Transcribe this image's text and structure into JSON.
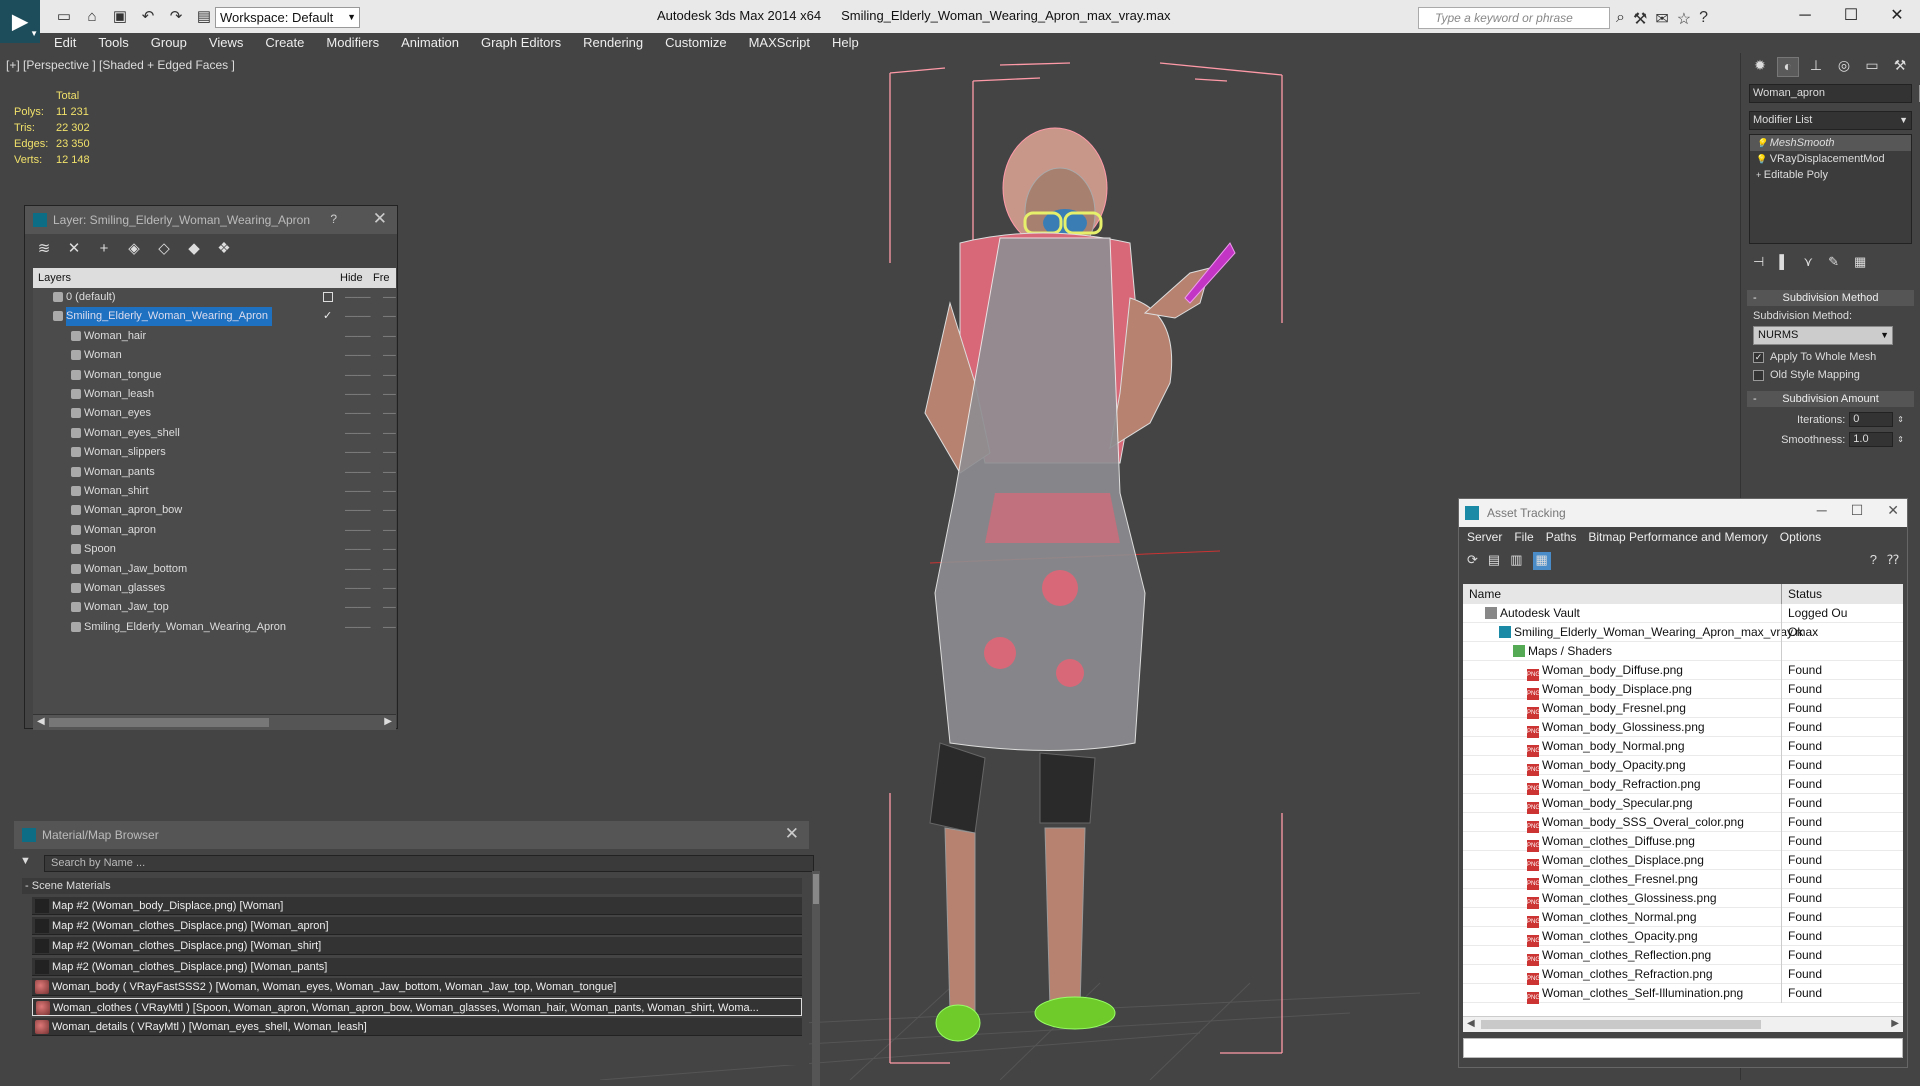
{
  "app": {
    "title": "Autodesk 3ds Max  2014 x64",
    "filename": "Smiling_Elderly_Woman_Wearing_Apron_max_vray.max",
    "workspace": "Workspace: Default",
    "search_placeholder": "Type a keyword or phrase"
  },
  "menu": [
    "Edit",
    "Tools",
    "Group",
    "Views",
    "Create",
    "Modifiers",
    "Animation",
    "Graph Editors",
    "Rendering",
    "Customize",
    "MAXScript",
    "Help"
  ],
  "viewport": {
    "label": "[+] [Perspective ] [Shaded + Edged Faces ]",
    "stats": {
      "header": "Total",
      "rows": [
        {
          "label": "Polys:",
          "value": "11 231"
        },
        {
          "label": "Tris:",
          "value": "22 302"
        },
        {
          "label": "Edges:",
          "value": "23 350"
        },
        {
          "label": "Verts:",
          "value": "12 148"
        }
      ]
    }
  },
  "layer_panel": {
    "title": "Layer: Smiling_Elderly_Woman_Wearing_Apron",
    "help": "?",
    "col_layers": "Layers",
    "col_hide": "Hide",
    "col_freeze": "Fre",
    "rows": [
      {
        "name": "0 (default)",
        "indent": 0
      },
      {
        "name": "Smiling_Elderly_Woman_Wearing_Apron",
        "indent": 0,
        "selected": true
      },
      {
        "name": "Woman_hair",
        "indent": 1
      },
      {
        "name": "Woman",
        "indent": 1
      },
      {
        "name": "Woman_tongue",
        "indent": 1
      },
      {
        "name": "Woman_leash",
        "indent": 1
      },
      {
        "name": "Woman_eyes",
        "indent": 1
      },
      {
        "name": "Woman_eyes_shell",
        "indent": 1
      },
      {
        "name": "Woman_slippers",
        "indent": 1
      },
      {
        "name": "Woman_pants",
        "indent": 1
      },
      {
        "name": "Woman_shirt",
        "indent": 1
      },
      {
        "name": "Woman_apron_bow",
        "indent": 1
      },
      {
        "name": "Woman_apron",
        "indent": 1
      },
      {
        "name": "Spoon",
        "indent": 1
      },
      {
        "name": "Woman_Jaw_bottom",
        "indent": 1
      },
      {
        "name": "Woman_glasses",
        "indent": 1
      },
      {
        "name": "Woman_Jaw_top",
        "indent": 1
      },
      {
        "name": "Smiling_Elderly_Woman_Wearing_Apron",
        "indent": 1
      }
    ]
  },
  "material_browser": {
    "title": "Material/Map Browser",
    "search_placeholder": "Search by Name ...",
    "group": "Scene Materials",
    "rows": [
      {
        "text": "Map #2 (Woman_body_Displace.png) [Woman]",
        "kind": "map"
      },
      {
        "text": "Map #2 (Woman_clothes_Displace.png) [Woman_apron]",
        "kind": "map"
      },
      {
        "text": "Map #2 (Woman_clothes_Displace.png) [Woman_shirt]",
        "kind": "map"
      },
      {
        "text": "Map #2 (Woman_clothes_Displace.png) [Woman_pants]",
        "kind": "map"
      },
      {
        "text": "Woman_body  ( VRayFastSSS2 )  [Woman, Woman_eyes, Woman_Jaw_bottom, Woman_Jaw_top, Woman_tongue]",
        "kind": "mat"
      },
      {
        "text": "Woman_clothes  ( VRayMtl )  [Spoon, Woman_apron, Woman_apron_bow, Woman_glasses, Woman_hair, Woman_pants, Woman_shirt, Woma...",
        "kind": "mat",
        "selected": true
      },
      {
        "text": "Woman_details  ( VRayMtl )  [Woman_eyes_shell, Woman_leash]",
        "kind": "mat"
      }
    ]
  },
  "command_panel": {
    "object_name": "Woman_apron",
    "modifier_list": "Modifier List",
    "stack": [
      "MeshSmooth",
      "VRayDisplacementMod",
      "Editable Poly"
    ],
    "subdivision_method_rollout": "Subdivision Method",
    "subdivision_method_label": "Subdivision Method:",
    "subdivision_method_value": "NURMS",
    "apply_whole_mesh": "Apply To Whole Mesh",
    "apply_whole_mesh_checked": true,
    "old_style_mapping": "Old Style Mapping",
    "old_style_mapping_checked": false,
    "subdivision_amount_rollout": "Subdivision Amount",
    "iterations_label": "Iterations:",
    "iterations_value": "0",
    "smoothness_label": "Smoothness:",
    "smoothness_value": "1.0"
  },
  "asset_tracking": {
    "title": "Asset Tracking",
    "menu": [
      "Server",
      "File",
      "Paths",
      "Bitmap Performance and Memory",
      "Options"
    ],
    "col_name": "Name",
    "col_status": "Status",
    "rows": [
      {
        "name": "Autodesk Vault",
        "status": "Logged Ou",
        "indent": 1,
        "icon": "vault"
      },
      {
        "name": "Smiling_Elderly_Woman_Wearing_Apron_max_vray.max",
        "status": "Ok",
        "indent": 2,
        "icon": "max"
      },
      {
        "name": "Maps / Shaders",
        "status": "",
        "indent": 3,
        "icon": "folder"
      },
      {
        "name": "Woman_body_Diffuse.png",
        "status": "Found",
        "indent": 4,
        "icon": "png"
      },
      {
        "name": "Woman_body_Displace.png",
        "status": "Found",
        "indent": 4,
        "icon": "png"
      },
      {
        "name": "Woman_body_Fresnel.png",
        "status": "Found",
        "indent": 4,
        "icon": "png"
      },
      {
        "name": "Woman_body_Glossiness.png",
        "status": "Found",
        "indent": 4,
        "icon": "png"
      },
      {
        "name": "Woman_body_Normal.png",
        "status": "Found",
        "indent": 4,
        "icon": "png"
      },
      {
        "name": "Woman_body_Opacity.png",
        "status": "Found",
        "indent": 4,
        "icon": "png"
      },
      {
        "name": "Woman_body_Refraction.png",
        "status": "Found",
        "indent": 4,
        "icon": "png"
      },
      {
        "name": "Woman_body_Specular.png",
        "status": "Found",
        "indent": 4,
        "icon": "png"
      },
      {
        "name": "Woman_body_SSS_Overal_color.png",
        "status": "Found",
        "indent": 4,
        "icon": "png"
      },
      {
        "name": "Woman_clothes_Diffuse.png",
        "status": "Found",
        "indent": 4,
        "icon": "png"
      },
      {
        "name": "Woman_clothes_Displace.png",
        "status": "Found",
        "indent": 4,
        "icon": "png"
      },
      {
        "name": "Woman_clothes_Fresnel.png",
        "status": "Found",
        "indent": 4,
        "icon": "png"
      },
      {
        "name": "Woman_clothes_Glossiness.png",
        "status": "Found",
        "indent": 4,
        "icon": "png"
      },
      {
        "name": "Woman_clothes_Normal.png",
        "status": "Found",
        "indent": 4,
        "icon": "png"
      },
      {
        "name": "Woman_clothes_Opacity.png",
        "status": "Found",
        "indent": 4,
        "icon": "png"
      },
      {
        "name": "Woman_clothes_Reflection.png",
        "status": "Found",
        "indent": 4,
        "icon": "png"
      },
      {
        "name": "Woman_clothes_Refraction.png",
        "status": "Found",
        "indent": 4,
        "icon": "png"
      },
      {
        "name": "Woman_clothes_Self-Illumination.png",
        "status": "Found",
        "indent": 4,
        "icon": "png"
      }
    ]
  },
  "colors": {
    "accent_selection": "#1e70c0",
    "stats_text": "#f0e06a",
    "wireframe_pink": "#ff9aa8"
  }
}
